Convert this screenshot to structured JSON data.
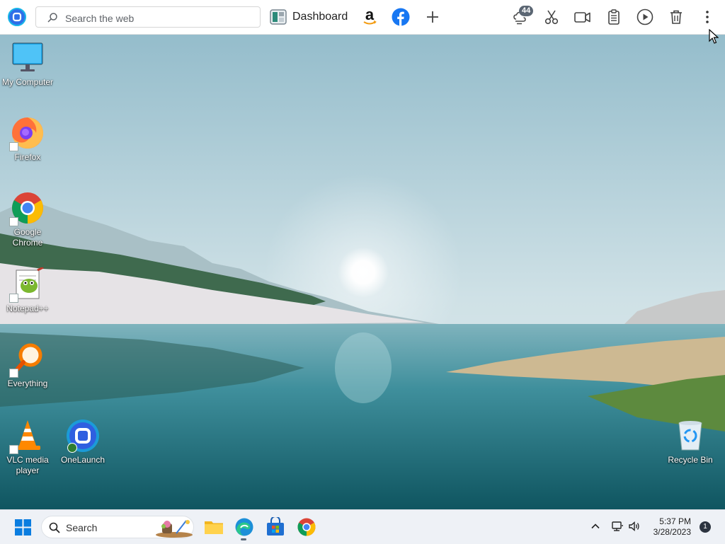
{
  "topbar": {
    "logo": "onelaunch-logo-icon",
    "search": {
      "placeholder": "Search the web"
    },
    "dashboard_label": "Dashboard",
    "shortcuts": [
      "amazon-icon",
      "facebook-icon",
      "add-icon"
    ],
    "tools": [
      "weather-icon",
      "scissors-icon",
      "video-camera-icon",
      "clipboard-icon",
      "play-icon",
      "trash-icon",
      "more-options-icon"
    ],
    "weather_badge": "44"
  },
  "desktop": {
    "icons": [
      {
        "label": "My Computer",
        "icon": "monitor-icon"
      },
      {
        "label": "Firefox",
        "icon": "firefox-icon"
      },
      {
        "label": "Google Chrome",
        "icon": "chrome-icon"
      },
      {
        "label": "Notepad++",
        "icon": "notepadpp-icon"
      },
      {
        "label": "Everything",
        "icon": "everything-search-icon"
      },
      {
        "label": "VLC media player",
        "icon": "vlc-icon"
      },
      {
        "label": "OneLaunch",
        "icon": "onelaunch-icon"
      },
      {
        "label": "Recycle Bin",
        "icon": "recycle-bin-icon"
      }
    ]
  },
  "taskbar": {
    "search_placeholder": "Search",
    "apps": [
      "file-explorer-icon",
      "edge-icon",
      "microsoft-store-icon",
      "chrome-icon"
    ],
    "time": "5:37 PM",
    "date": "3/28/2023",
    "notification_count": "1"
  },
  "colors": {
    "accent_blue": "#1877f2",
    "taskbar_bg": "#eef1f6",
    "topbar_bg": "#ffffff"
  }
}
